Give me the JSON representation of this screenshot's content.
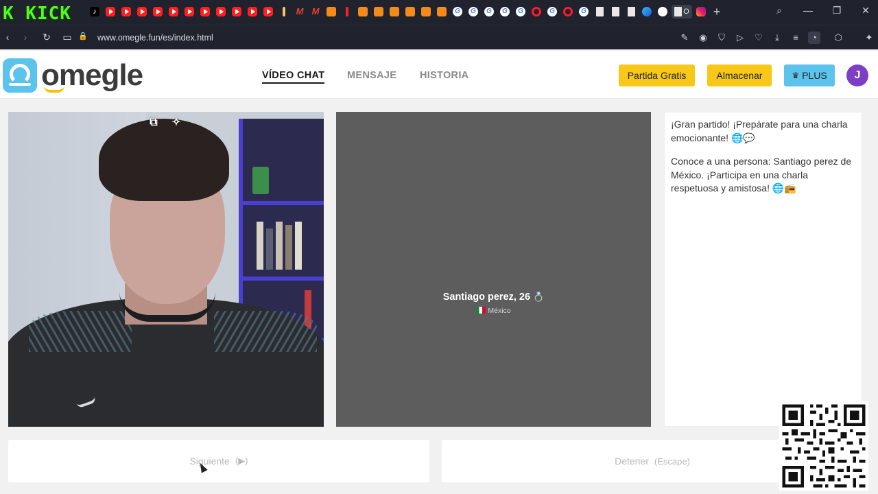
{
  "browser": {
    "stream_logo": "K KICK",
    "url": "www.omegle.fun/es/index.html",
    "active_tab_label": "O"
  },
  "site": {
    "logo_text": "omegle",
    "nav": [
      {
        "label": "VÍDEO CHAT",
        "active": true
      },
      {
        "label": "MENSAJE",
        "active": false
      },
      {
        "label": "HISTORIA",
        "active": false
      }
    ],
    "buttons": {
      "free_match": "Partida Gratis",
      "store": "Almacenar",
      "plus": "PLUS"
    },
    "avatar_initial": "J"
  },
  "stranger": {
    "name_age": "Santiago perez, 26",
    "country": "México"
  },
  "chat": {
    "messages": [
      "¡Gran partido! ¡Prepárate para una charla emocionante! 🌐💬",
      "Conoce a una persona: Santiago perez de México. ¡Participa en una charla respetuosa y amistosa! 🌐📻"
    ]
  },
  "controls": {
    "next_label": "Siguiente",
    "next_hint": "(▶)",
    "stop_label": "Detener",
    "stop_hint": "(Escape)"
  },
  "colors": {
    "accent_yellow": "#f7c817",
    "accent_blue": "#5cc3ec",
    "avatar_purple": "#7c3fc4"
  }
}
